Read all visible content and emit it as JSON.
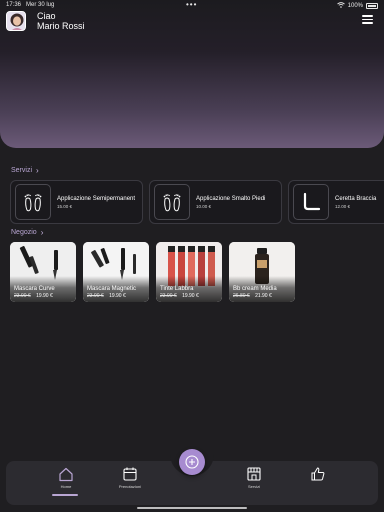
{
  "status": {
    "time": "17:36",
    "date": "Mer 30 lug",
    "battery": "100%"
  },
  "header": {
    "greeting": "Ciao",
    "user_name": "Mario Rossi",
    "menu_icon": "hamburger-menu-icon"
  },
  "services": {
    "title": "Servizi",
    "items": [
      {
        "name": "Applicazione Semipermanent",
        "price": "15.00 €",
        "icon": "feet-icon"
      },
      {
        "name": "Applicazione Smalto Piedi",
        "price": "10.00 €",
        "icon": "feet-icon"
      },
      {
        "name": "Ceretta Braccia",
        "price": "12.00 €",
        "icon": "arm-icon"
      }
    ]
  },
  "shop": {
    "title": "Negozio",
    "items": [
      {
        "name": "Mascara Curve",
        "old_price": "23.90 €",
        "new_price": "19.90 €"
      },
      {
        "name": "Mascara Magnetic",
        "old_price": "23.90 €",
        "new_price": "19.90 €"
      },
      {
        "name": "Tinte Labbra",
        "old_price": "23.90 €",
        "new_price": "19.90 €"
      },
      {
        "name": "Bb cream Media",
        "old_price": "26.80 €",
        "new_price": "21.90 €"
      }
    ]
  },
  "nav": {
    "items": [
      {
        "label": "Home",
        "icon": "home-icon",
        "active": true
      },
      {
        "label": "Prenotazioni",
        "icon": "calendar-icon",
        "active": false
      },
      {
        "label": "Servizi",
        "icon": "store-icon",
        "active": false
      },
      {
        "label": "",
        "icon": "thumbs-up-icon",
        "active": false
      }
    ],
    "fab_icon": "plus-icon"
  },
  "colors": {
    "accent": "#a78bd0",
    "background": "#1f1e21",
    "section_title": "#b9a6d3"
  }
}
